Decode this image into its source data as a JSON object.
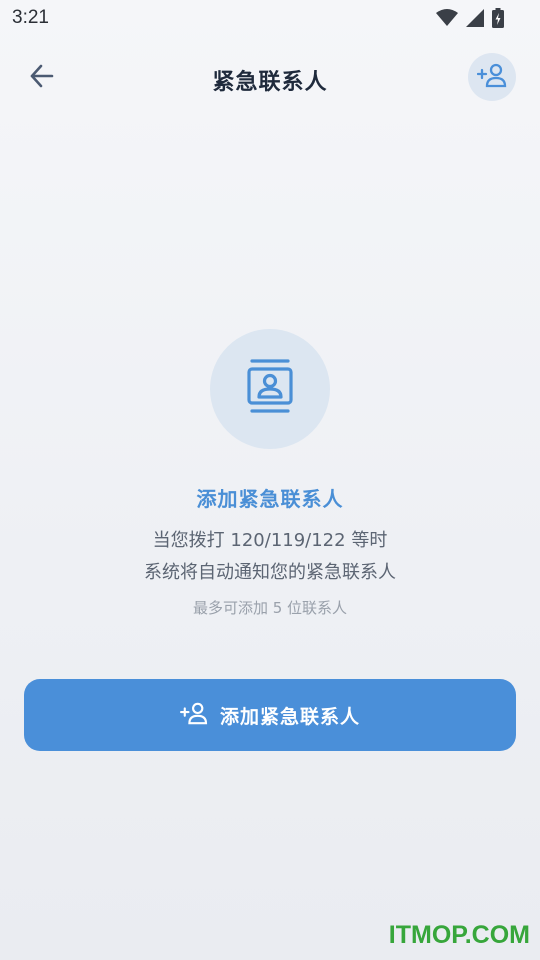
{
  "status_bar": {
    "time": "3:21",
    "icons": [
      "wifi-icon",
      "signal-icon",
      "battery-charging-icon"
    ]
  },
  "app_bar": {
    "back_icon": "arrow-left-icon",
    "title": "紧急联系人",
    "action_icon": "person-add-icon"
  },
  "empty_state": {
    "illustration_icon": "contact-card-icon",
    "title": "添加紧急联系人",
    "description_line_1": "当您拨打 120/119/122 等时",
    "description_line_2": "系统将自动通知您的紧急联系人",
    "hint": "最多可添加 5 位联系人"
  },
  "primary_action": {
    "icon": "person-add-icon",
    "label": "添加紧急联系人"
  },
  "watermark": "ITMOP.COM",
  "colors": {
    "accent": "#4a8fd9",
    "title_accent": "#4a8fd6",
    "illustration_bg": "#dce6f1",
    "watermark": "#37a63b"
  }
}
